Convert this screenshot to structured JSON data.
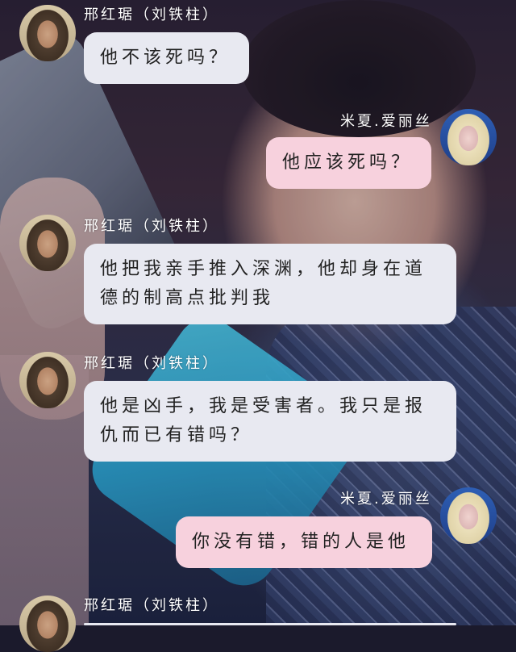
{
  "messages": [
    {
      "side": "left",
      "sender": "邢红琚（刘铁柱）",
      "text": "他不该死吗？"
    },
    {
      "side": "right",
      "sender": "米夏.爱丽丝",
      "text": "他应该死吗？"
    },
    {
      "side": "left",
      "sender": "邢红琚（刘铁柱）",
      "text": "他把我亲手推入深渊，他却身在道德的制高点批判我"
    },
    {
      "side": "left",
      "sender": "邢红琚（刘铁柱）",
      "text": "他是凶手，我是受害者。我只是报仇而已有错吗？"
    },
    {
      "side": "right",
      "sender": "米夏.爱丽丝",
      "text": "你没有错，错的人是他"
    },
    {
      "side": "left",
      "sender": "邢红琚（刘铁柱）",
      "text": ""
    }
  ],
  "colors": {
    "left_bubble": "#e8e9f1",
    "right_bubble": "#f7d1dd",
    "name_text": "#ffffff",
    "message_text": "#222222"
  }
}
